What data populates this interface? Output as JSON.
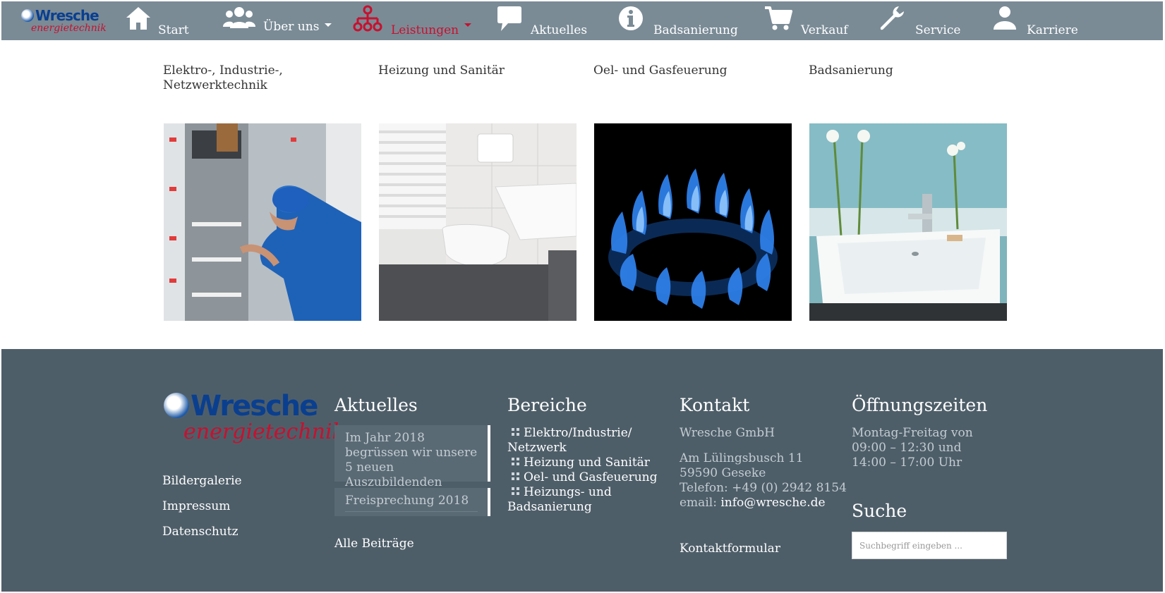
{
  "logo": {
    "top": "Wresche",
    "bottom": "energietechnik"
  },
  "nav": {
    "items": [
      {
        "label": "Start",
        "icon": "home-icon"
      },
      {
        "label": "Über uns",
        "icon": "users-icon"
      },
      {
        "label": "Leistungen",
        "icon": "network-icon",
        "active": true
      },
      {
        "label": "Aktuelles",
        "icon": "speech-bubble-icon"
      },
      {
        "label": "Badsanierung",
        "icon": "info-icon"
      },
      {
        "label": "Verkauf",
        "icon": "cart-icon"
      },
      {
        "label": "Service",
        "icon": "wrench-icon"
      },
      {
        "label": "Karriere",
        "icon": "user-icon"
      }
    ]
  },
  "services": [
    {
      "title": "Elektro-, Industrie-, Netzwerktechnik",
      "image": "electrician-at-panel"
    },
    {
      "title": "Heizung und Sanitär",
      "image": "bathroom-toilet-radiator"
    },
    {
      "title": "Oel- und Gasfeuerung",
      "image": "gas-burner-flame"
    },
    {
      "title": "Badsanierung",
      "image": "washbasin-tulips"
    }
  ],
  "footer": {
    "logo": {
      "top": "Wresche",
      "bottom": "energietechnik"
    },
    "links": [
      "Bildergalerie",
      "Impressum",
      "Datenschutz"
    ],
    "aktuelles": {
      "heading": "Aktuelles",
      "posts": [
        "Im Jahr 2018 begrüssen wir unsere 5 neuen Auszubildenden",
        "Freisprechung 2018"
      ],
      "all_posts": "Alle Beiträge"
    },
    "bereiche": {
      "heading": "Bereiche",
      "items": [
        "Elektro/Industrie/ Netzwerk",
        "Heizung und Sanitär",
        "Oel- und Gasfeuerung",
        "Heizungs- und Badsanierung"
      ]
    },
    "kontakt": {
      "heading": "Kontakt",
      "company": "Wresche GmbH",
      "street": "Am Lülingsbusch 11",
      "city": "59590 Geseke",
      "phone": "Telefon: +49 (0) 2942 8154",
      "email_label": "email:",
      "email": "info@wresche.de",
      "form_link": "Kontaktformular"
    },
    "hours": {
      "heading": "Öffnungszeiten",
      "line1": "Montag-Freitag von",
      "line2": "09:00 – 12:30 und",
      "line3": "14:00 – 17:00 Uhr"
    },
    "search": {
      "heading": "Suche",
      "placeholder": "Suchbegriff eingeben ..."
    }
  },
  "colors": {
    "nav_bg": "#7a8b96",
    "footer_bg": "#4e5e69",
    "accent_red": "#c8102e",
    "logo_blue": "#0a3f8f"
  }
}
